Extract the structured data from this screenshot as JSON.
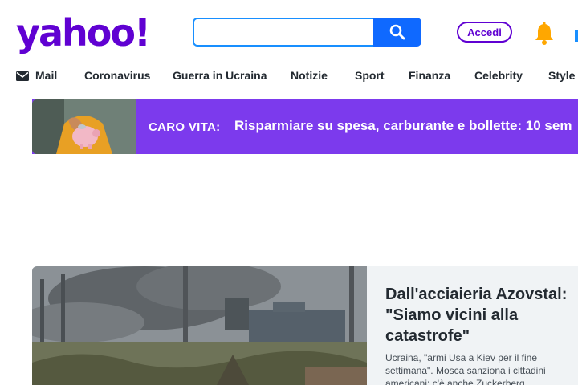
{
  "header": {
    "logo_text": "yahoo!",
    "search": {
      "value": "",
      "placeholder": ""
    },
    "signin_label": "Accedi",
    "brand_color": "#6001d2",
    "accent_color": "#0f69ff"
  },
  "nav": {
    "items": [
      {
        "label": "Mail",
        "icon": "mail-icon"
      },
      {
        "label": "Coronavirus"
      },
      {
        "label": "Guerra in Ucraina"
      },
      {
        "label": "Notizie"
      },
      {
        "label": "Sport"
      },
      {
        "label": "Finanza"
      },
      {
        "label": "Celebrity"
      },
      {
        "label": "Style"
      }
    ]
  },
  "promo": {
    "label": "CARO VITA:",
    "title": "Risparmiare su spesa, carburante e bollette: 10 sem",
    "background": "#7c3aed"
  },
  "hero": {
    "title": "Dall'acciaieria Azovstal: \"Siamo vicini alla catastrofe\"",
    "summary": "Ucraina, \"armi Usa a Kiev per il fine settimana\". Mosca sanziona i cittadini americani: c'è anche Zuckerberg"
  }
}
